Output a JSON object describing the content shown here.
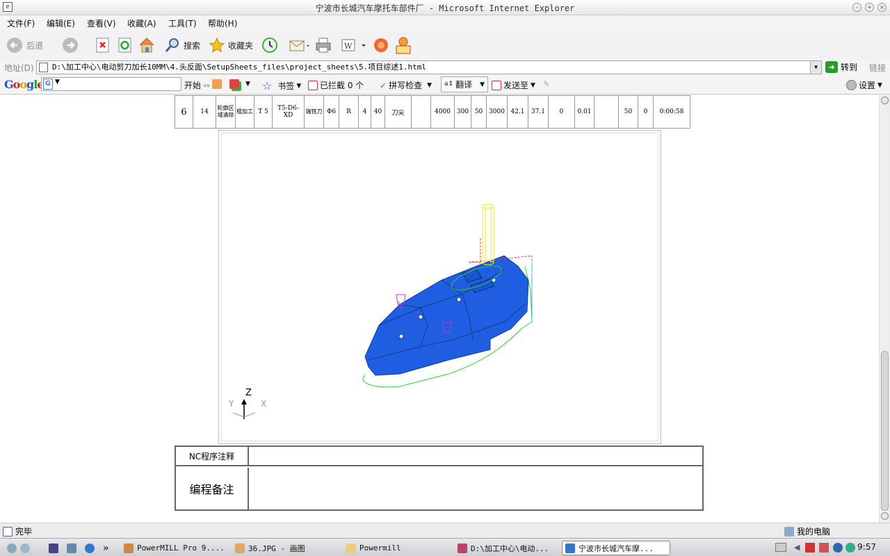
{
  "window": {
    "title": "宁波市长城汽车摩托车部件厂 - Microsoft Internet Explorer"
  },
  "menu": [
    "文件(F)",
    "编辑(E)",
    "查看(V)",
    "收藏(A)",
    "工具(T)",
    "帮助(H)"
  ],
  "toolbar": {
    "back": "后退",
    "search": "搜索",
    "favorites": "收藏夹"
  },
  "address": {
    "label": "地址(D)",
    "value": "D:\\加工中心\\电动剪刀加长10MM\\4.头反面\\SetupSheets_files\\project_sheets\\5.项目综述1.html",
    "go": "转到",
    "links": "链接"
  },
  "google": {
    "logo": "Google",
    "start": "开始",
    "bookmarks": "书签",
    "blocked": "已拦截 0 个",
    "spellcheck": "拼写检查",
    "translate": "翻译",
    "sendto": "发送至",
    "settings": "设置"
  },
  "ops_row": [
    "6",
    "14",
    "轮廓区域清除",
    "粗加工",
    "T 5",
    "T5-D6-XD",
    "端铣刀",
    "Φ6",
    "R",
    "4",
    "40",
    "刀尖",
    "",
    "4000",
    "300",
    "50",
    "3000",
    "42.1",
    "37.1",
    "0",
    "0.01",
    "",
    "50",
    "0",
    "0:00:58"
  ],
  "axes": {
    "z": "Z",
    "y": "Y",
    "x": "X"
  },
  "notes": {
    "nc_label": "NC程序注释",
    "prog_label": "编程备注"
  },
  "status": {
    "done": "完毕",
    "zone": "我的电脑"
  },
  "taskbar": {
    "tasks": [
      "PowerMILL Pro 9....",
      "36.JPG - 画图",
      "Powermill",
      "D:\\加工中心\\电动...",
      "宁波市长城汽车摩..."
    ],
    "clock": "9:57"
  }
}
